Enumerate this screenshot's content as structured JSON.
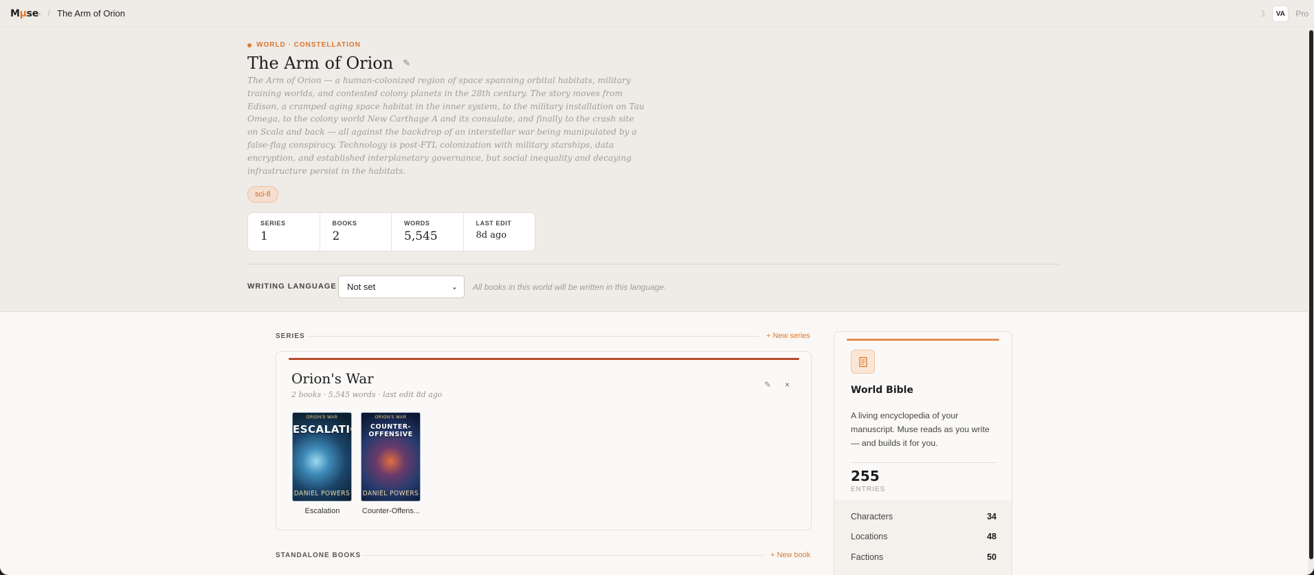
{
  "app": {
    "logo_m": "M",
    "logo_mu": "μ",
    "logo_se": "se",
    "logo_dot": "·"
  },
  "breadcrumb": {
    "separator": "/",
    "current": "The Arm of Orion"
  },
  "topbar": {
    "avatar": "VA",
    "plan": "Pro"
  },
  "world": {
    "kicker": "WORLD · CONSTELLATION",
    "title": "The Arm of Orion",
    "description": "The Arm of Orion — a human-colonized region of space spanning orbital habitats, military training worlds, and contested colony planets in the 28th century. The story moves from Edison, a cramped aging space habitat in the inner system, to the military installation on Tau Omega, to the colony world New Carthage A and its consulate, and finally to the crash site on Scala and back — all against the backdrop of an interstellar war being manipulated by a false-flag conspiracy. Technology is post-FTL colonization with military starships, data encryption, and established interplanetary governance, but social inequality and decaying infrastructure persist in the habitats.",
    "tag": "sci-fi",
    "stats": [
      {
        "label": "SERIES",
        "value": "1"
      },
      {
        "label": "BOOKS",
        "value": "2"
      },
      {
        "label": "WORDS",
        "value": "5,545"
      },
      {
        "label": "LAST EDIT",
        "value": "8d ago"
      }
    ]
  },
  "language": {
    "label": "WRITING LANGUAGE",
    "selected": "Not set",
    "hint": "All books in this world will be written in this language."
  },
  "series_section": {
    "label": "SERIES",
    "action": "+ New series"
  },
  "series": {
    "title": "Orion's War",
    "meta": "2 books · 5,545 words · last edit 8d ago",
    "books": [
      {
        "label": "Escalation",
        "cover_top": "ORION'S WAR",
        "cover_title": "ESCALATION",
        "cover_author": "DANIEL POWERS"
      },
      {
        "label": "Counter-Offens...",
        "cover_top": "ORION'S WAR",
        "cover_title": "COUNTER-OFFENSIVE",
        "cover_author": "DANIEL POWERS"
      }
    ]
  },
  "standalone_section": {
    "label": "STANDALONE BOOKS",
    "action": "+ New book"
  },
  "bible": {
    "title": "World Bible",
    "description": "A living encyclopedia of your manuscript. Muse reads as you write — and builds it for you.",
    "count": "255",
    "count_label": "ENTRIES",
    "rows": [
      {
        "name": "Characters",
        "count": "34"
      },
      {
        "name": "Locations",
        "count": "48"
      },
      {
        "name": "Factions",
        "count": "50"
      }
    ]
  },
  "colors": {
    "accent": "#e07a2e",
    "series_accent": "#b64a2c",
    "hero_bg": "#efebe7"
  },
  "icons": {
    "edit": "pencil-icon",
    "close": "close-icon",
    "theme": "moon-icon",
    "bible": "scroll-icon"
  }
}
